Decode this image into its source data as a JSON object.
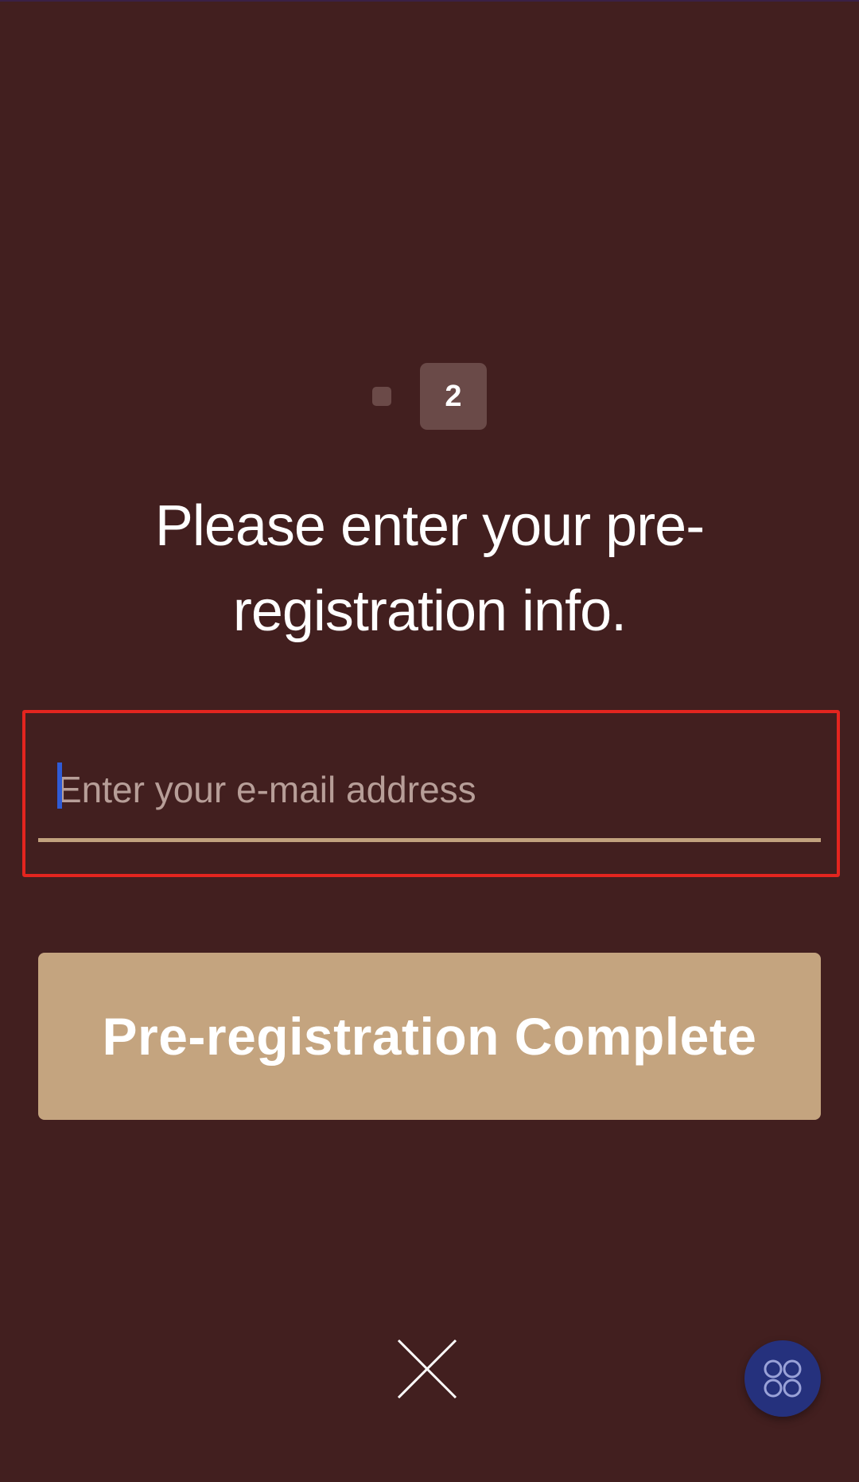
{
  "stepper": {
    "active_step": "2"
  },
  "form": {
    "headline": "Please enter your pre-registration info.",
    "email_placeholder": "Enter your e-mail address",
    "submit_label": "Pre-registration Complete"
  },
  "icons": {
    "close": "close-icon",
    "floating_menu": "grid-icon"
  },
  "colors": {
    "background": "#421f1f",
    "accent_button": "#c4a47f",
    "input_underline": "#c2a27e",
    "highlight_frame": "#e3251f",
    "step_badge": "#6a4a48",
    "floating_button": "#25317d"
  }
}
